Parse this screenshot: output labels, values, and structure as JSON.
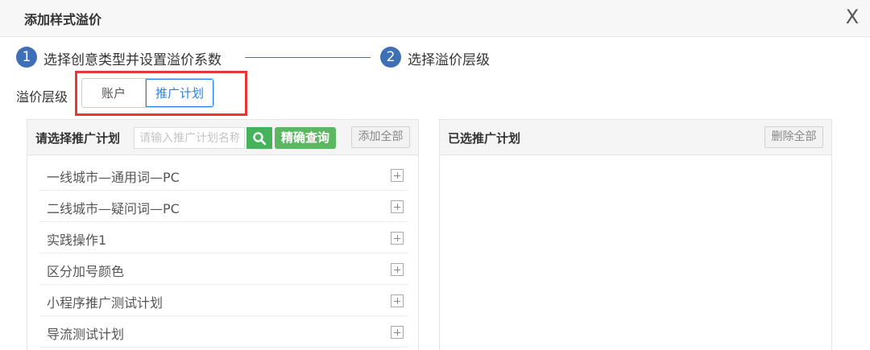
{
  "dialog": {
    "title": "添加样式溢价",
    "close_glyph": "X"
  },
  "steps": [
    {
      "number": "1",
      "label": "选择创意类型并设置溢价系数"
    },
    {
      "number": "2",
      "label": "选择溢价层级"
    }
  ],
  "premium_level": {
    "label": "溢价层级",
    "options": [
      "账户",
      "推广计划"
    ],
    "selected": "推广计划"
  },
  "left_panel": {
    "title": "请选择推广计划",
    "search_placeholder": "请输入推广计划名称",
    "search_icon": "search-icon",
    "exact_query_label": "精确查询",
    "add_all_label": "添加全部",
    "items": [
      "一线城市—通用词—PC",
      "二线城市—疑问词—PC",
      "实践操作1",
      "区分加号颜色",
      "小程序推广测试计划",
      "导流测试计划"
    ]
  },
  "right_panel": {
    "title": "已选推广计划",
    "delete_all_label": "删除全部"
  },
  "colors": {
    "accent": "#3e6fb7",
    "selected": "#2a82e4",
    "search_green": "#44b35a",
    "highlight_red": "#e83535"
  }
}
